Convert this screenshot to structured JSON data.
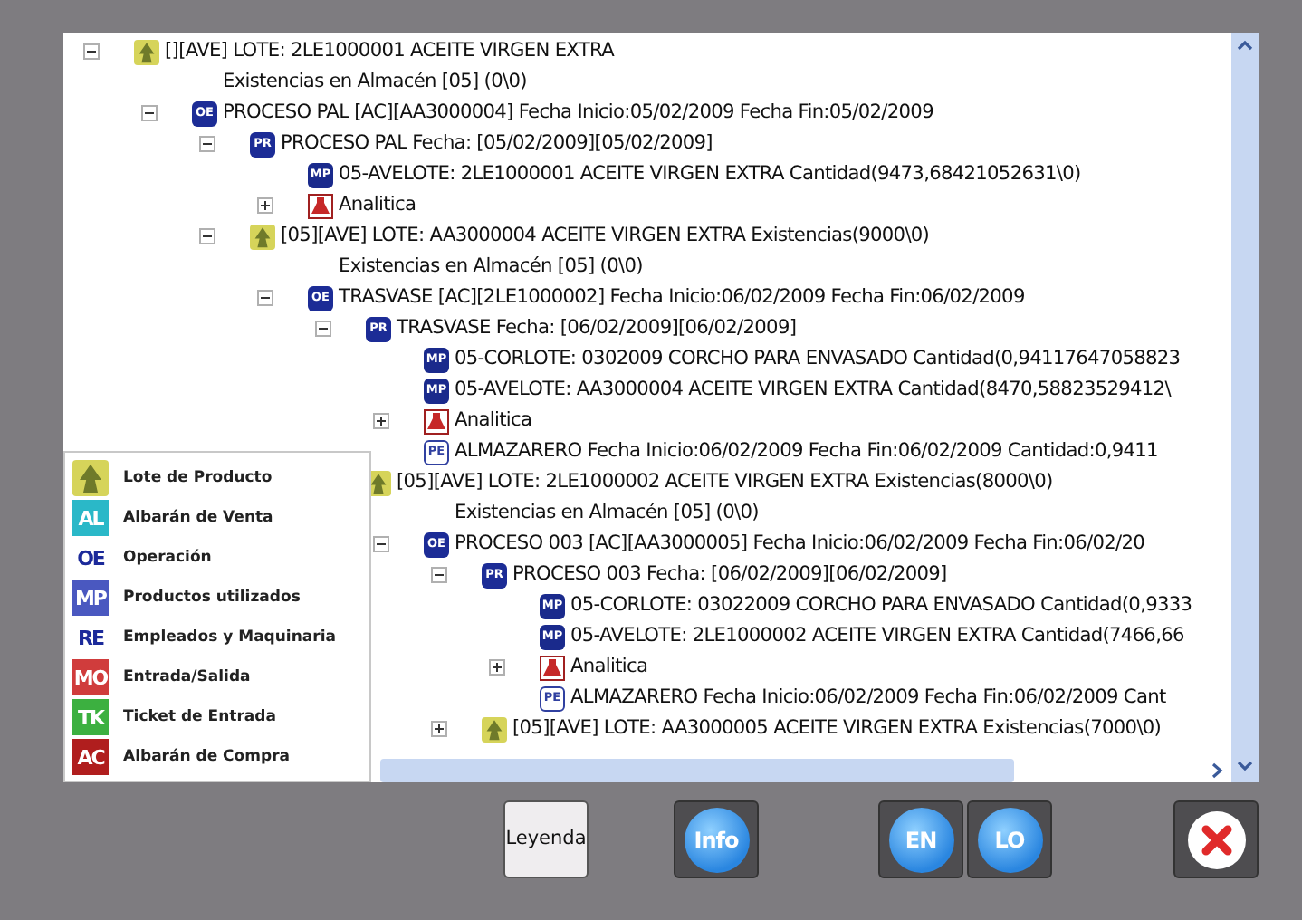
{
  "tree": [
    {
      "kind": "lote",
      "text": "[][AVE] LOTE: 2LE1000001 ACEITE VIRGEN EXTRA",
      "expanded": true,
      "children": [
        {
          "kind": "plain",
          "text": "Existencias en Almacén [05] (0\\0)"
        },
        {
          "kind": "oe",
          "icon_label": "OE",
          "text": "PROCESO PAL [AC][AA3000004] Fecha Inicio:05/02/2009 Fecha Fin:05/02/2009",
          "expanded": true,
          "children": [
            {
              "kind": "pr",
              "icon_label": "PR",
              "text": "PROCESO PAL Fecha: [05/02/2009][05/02/2009]",
              "expanded": true,
              "children": [
                {
                  "kind": "mp",
                  "icon_label": "MP",
                  "text": "05-AVELOTE: 2LE1000001 ACEITE VIRGEN EXTRA Cantidad(9473,68421052631\\0)"
                },
                {
                  "kind": "analitica",
                  "text": "Analitica",
                  "expanded": false
                }
              ]
            },
            {
              "kind": "lote",
              "text": "[05][AVE] LOTE: AA3000004 ACEITE VIRGEN EXTRA Existencias(9000\\0)",
              "expanded": true,
              "children": [
                {
                  "kind": "plain",
                  "text": "Existencias en Almacén [05] (0\\0)"
                },
                {
                  "kind": "oe",
                  "icon_label": "OE",
                  "text": "TRASVASE [AC][2LE1000002] Fecha Inicio:06/02/2009 Fecha Fin:06/02/2009",
                  "expanded": true,
                  "children": [
                    {
                      "kind": "pr",
                      "icon_label": "PR",
                      "text": "TRASVASE Fecha: [06/02/2009][06/02/2009]",
                      "expanded": true,
                      "children": [
                        {
                          "kind": "mp",
                          "icon_label": "MP",
                          "text": "05-CORLOTE: 0302009 CORCHO PARA ENVASADO Cantidad(0,94117647058823"
                        },
                        {
                          "kind": "mp",
                          "icon_label": "MP",
                          "text": "05-AVELOTE: AA3000004 ACEITE VIRGEN EXTRA Cantidad(8470,58823529412\\"
                        },
                        {
                          "kind": "analitica",
                          "text": "Analitica",
                          "expanded": false
                        },
                        {
                          "kind": "pe",
                          "icon_label": "PE",
                          "text": "ALMAZARERO Fecha Inicio:06/02/2009 Fecha Fin:06/02/2009 Cantidad:0,9411"
                        }
                      ]
                    },
                    {
                      "kind": "lote",
                      "text": "[05][AVE] LOTE: 2LE1000002 ACEITE VIRGEN EXTRA Existencias(8000\\0)",
                      "children": [
                        {
                          "kind": "plain",
                          "text": "Existencias en Almacén [05] (0\\0)"
                        },
                        {
                          "kind": "oe",
                          "icon_label": "OE",
                          "text": "PROCESO 003 [AC][AA3000005] Fecha Inicio:06/02/2009 Fecha Fin:06/02/20",
                          "expanded": true,
                          "children": [
                            {
                              "kind": "pr",
                              "icon_label": "PR",
                              "text": "PROCESO 003 Fecha: [06/02/2009][06/02/2009]",
                              "expanded": true,
                              "children": [
                                {
                                  "kind": "mp",
                                  "icon_label": "MP",
                                  "text": "05-CORLOTE: 03022009 CORCHO PARA ENVASADO Cantidad(0,9333"
                                },
                                {
                                  "kind": "mp",
                                  "icon_label": "MP",
                                  "text": "05-AVELOTE: 2LE1000002 ACEITE VIRGEN EXTRA Cantidad(7466,66"
                                },
                                {
                                  "kind": "analitica",
                                  "text": "Analitica",
                                  "expanded": false
                                },
                                {
                                  "kind": "pe",
                                  "icon_label": "PE",
                                  "text": "ALMAZARERO Fecha Inicio:06/02/2009 Fecha Fin:06/02/2009 Cant"
                                }
                              ]
                            },
                            {
                              "kind": "lote",
                              "text": "[05][AVE] LOTE: AA3000005 ACEITE VIRGEN EXTRA Existencias(7000\\0)",
                              "expanded": false
                            }
                          ]
                        }
                      ]
                    }
                  ]
                }
              ]
            }
          ]
        }
      ]
    }
  ],
  "legend": [
    {
      "kind": "lote",
      "label": "Lote de Producto"
    },
    {
      "kind": "code",
      "code": "AL",
      "label": "Albarán de Venta",
      "color": "#2ab8c8",
      "filled": true
    },
    {
      "kind": "code",
      "code": "OE",
      "label": "Operación",
      "color": "#1c2a9a",
      "filled": false
    },
    {
      "kind": "code",
      "code": "MP",
      "label": "Productos utilizados",
      "color": "#4a58c0",
      "filled": true
    },
    {
      "kind": "code",
      "code": "RE",
      "label": "Empleados y Maquinaria",
      "color": "#1c2a9a",
      "filled": false
    },
    {
      "kind": "code",
      "code": "MO",
      "label": "Entrada/Salida",
      "color": "#d03c3c",
      "filled": true
    },
    {
      "kind": "code",
      "code": "TK",
      "label": "Ticket de Entrada",
      "color": "#3cb040",
      "filled": true
    },
    {
      "kind": "code",
      "code": "AC",
      "label": "Albarán de Compra",
      "color": "#b01e1e",
      "filled": true
    }
  ],
  "buttons": [
    {
      "kind": "text",
      "label": "Leyenda"
    },
    {
      "kind": "globe",
      "label": "Info"
    },
    {
      "kind": "globe",
      "label": "EN"
    },
    {
      "kind": "globe",
      "label": "LO"
    },
    {
      "kind": "close"
    }
  ]
}
